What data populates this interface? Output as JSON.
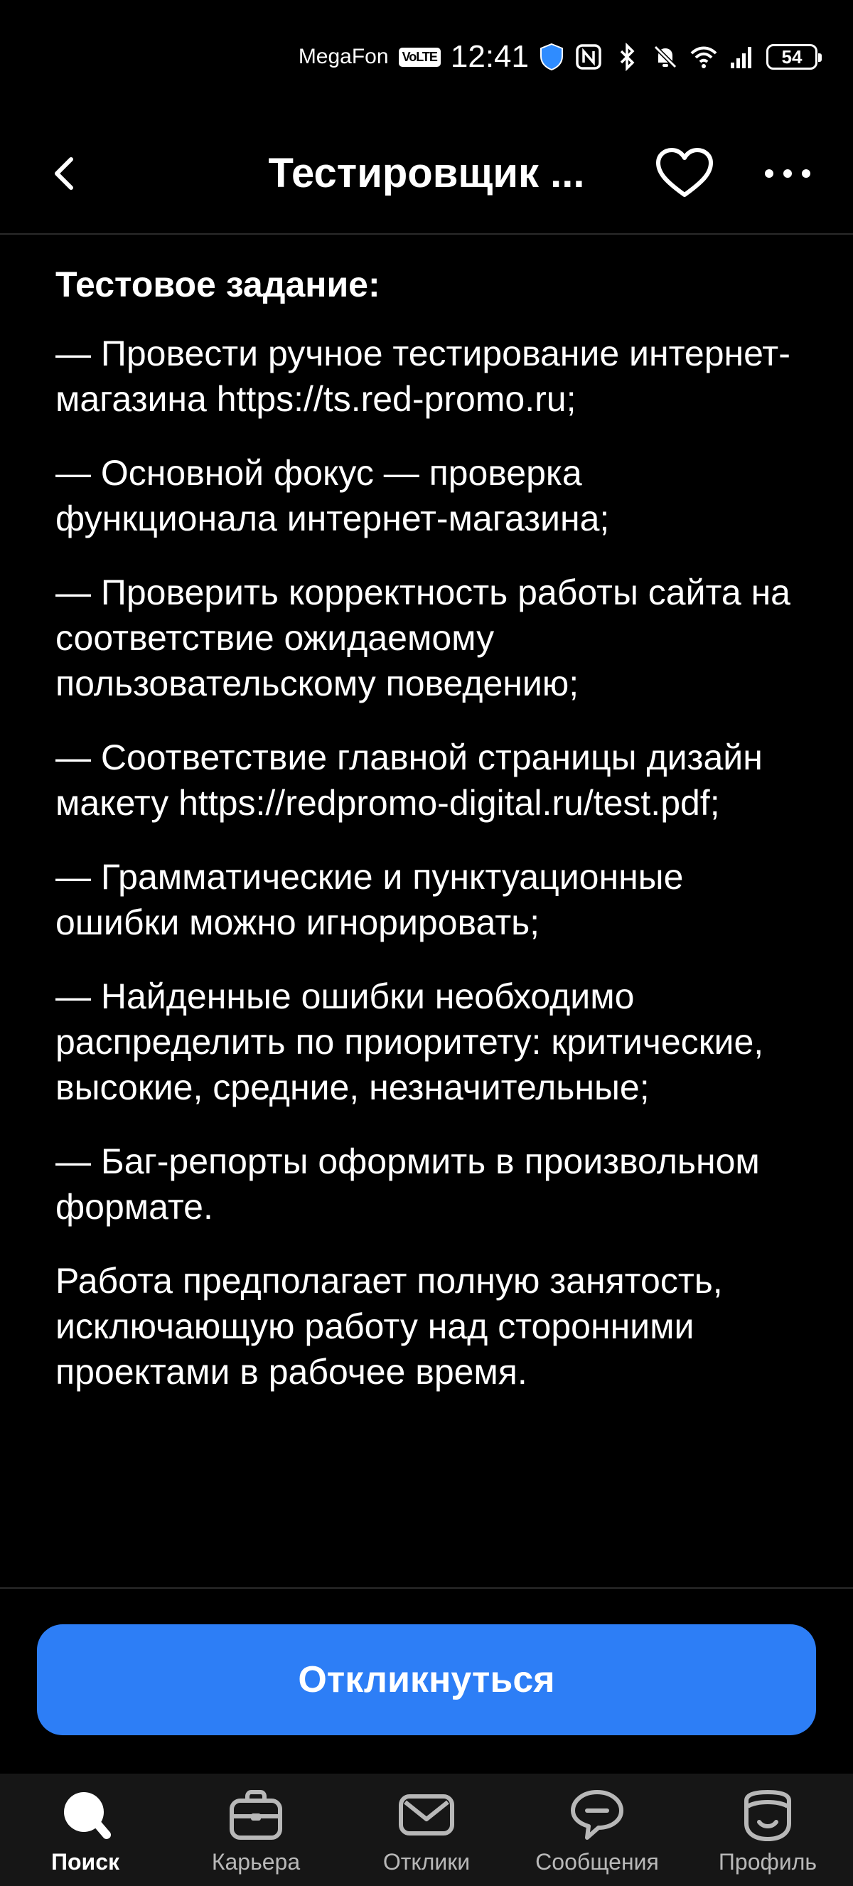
{
  "status_bar": {
    "carrier": "MegaFon",
    "volte": "VoLTE",
    "time": "12:41",
    "battery": "54"
  },
  "nav": {
    "title": "Тестировщик ...",
    "icons": [
      "chevron-left-icon",
      "heart-icon",
      "more-horizontal-icon"
    ]
  },
  "content": {
    "section_title": "Тестовое задание:",
    "paragraphs": [
      "— Провести ручное тестирование интернет-магазина https://ts.red-promo.ru;",
      "— Основной фокус — проверка функционала интернет-магазина;",
      "— Проверить корректность работы сайта на соответствие ожидаемому пользовательскому поведению;",
      "— Соответствие главной страницы дизайн макету https://redpromo-digital.ru/test.pdf;",
      "— Грамматические и пунктуационные ошибки можно игнорировать;",
      "— Найденные ошибки необходимо распределить по приоритету: критические, высокие, средние, незначительные;",
      "— Баг-репорты оформить в произвольном формате.",
      "Работа предполагает полную занятость, исключающую работу над сторонними проектами в рабочее время."
    ]
  },
  "apply_button": {
    "label": "Откликнуться",
    "color": "#2d7ef6"
  },
  "bottom_nav": {
    "items": [
      {
        "label": "Поиск",
        "icon": "search-icon",
        "active": true
      },
      {
        "label": "Карьера",
        "icon": "briefcase-icon",
        "active": false
      },
      {
        "label": "Отклики",
        "icon": "envelope-icon",
        "active": false
      },
      {
        "label": "Сообщения",
        "icon": "chat-icon",
        "active": false
      },
      {
        "label": "Профиль",
        "icon": "profile-icon",
        "active": false
      }
    ]
  }
}
